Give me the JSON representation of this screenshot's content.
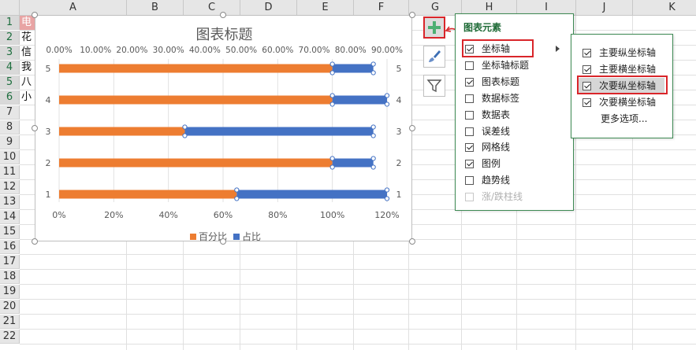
{
  "sheet": {
    "columns": [
      "A",
      "B",
      "C",
      "D",
      "E",
      "F",
      "G",
      "H",
      "I",
      "J",
      "K"
    ],
    "rows": [
      "1",
      "2",
      "3",
      "4",
      "5",
      "6",
      "7",
      "8",
      "9",
      "10",
      "11",
      "12",
      "13",
      "14",
      "15",
      "16",
      "17",
      "18",
      "19",
      "20",
      "21",
      "22"
    ],
    "a_cells": [
      "电",
      "花",
      "信",
      "我",
      "八",
      "小"
    ]
  },
  "chart": {
    "title": "图表标题",
    "legend": [
      "百分比",
      "占比"
    ]
  },
  "chart_data": {
    "type": "bar",
    "orientation": "horizontal-stacked",
    "categories": [
      "1",
      "2",
      "3",
      "4",
      "5"
    ],
    "series": [
      {
        "name": "百分比",
        "values": [
          0.65,
          1.0,
          0.46,
          1.0,
          1.0
        ],
        "color": "#ed7d31",
        "axis": "primary"
      },
      {
        "name": "占比",
        "values": [
          0.55,
          0.15,
          0.69,
          0.2,
          0.15
        ],
        "color": "#4472c4",
        "axis": "primary"
      }
    ],
    "primary_x_ticks": [
      "0%",
      "20%",
      "40%",
      "60%",
      "80%",
      "100%",
      "120%"
    ],
    "primary_x_range": [
      0,
      1.2
    ],
    "secondary_x_ticks": [
      "0.00%",
      "10.00%",
      "20.00%",
      "30.00%",
      "40.00%",
      "50.00%",
      "60.00%",
      "70.00%",
      "80.00%",
      "90.00%"
    ],
    "secondary_x_range": [
      0,
      0.9
    ],
    "grid": true,
    "legend_position": "bottom",
    "selected_series": "占比"
  },
  "elements_popup": {
    "title": "图表元素",
    "items": [
      {
        "label": "坐标轴",
        "checked": true,
        "disabled": false
      },
      {
        "label": "坐标轴标题",
        "checked": false,
        "disabled": false
      },
      {
        "label": "图表标题",
        "checked": true,
        "disabled": false
      },
      {
        "label": "数据标签",
        "checked": false,
        "disabled": false
      },
      {
        "label": "数据表",
        "checked": false,
        "disabled": false
      },
      {
        "label": "误差线",
        "checked": false,
        "disabled": false
      },
      {
        "label": "网格线",
        "checked": true,
        "disabled": false
      },
      {
        "label": "图例",
        "checked": true,
        "disabled": false
      },
      {
        "label": "趋势线",
        "checked": false,
        "disabled": false
      },
      {
        "label": "涨/跌柱线",
        "checked": false,
        "disabled": true
      }
    ]
  },
  "axis_submenu": {
    "items": [
      {
        "label": "主要纵坐标轴",
        "checked": true
      },
      {
        "label": "主要横坐标轴",
        "checked": true
      },
      {
        "label": "次要纵坐标轴",
        "checked": true
      },
      {
        "label": "次要横坐标轴",
        "checked": true
      }
    ],
    "more": "更多选项..."
  },
  "side_buttons": [
    {
      "icon": "plus-icon",
      "color": "#4caf72"
    },
    {
      "icon": "brush-icon",
      "color": "#3d6fb5"
    },
    {
      "icon": "filter-icon",
      "color": "#555555"
    }
  ],
  "colors": {
    "accent": "#d9252a",
    "green": "#1f6b37"
  }
}
